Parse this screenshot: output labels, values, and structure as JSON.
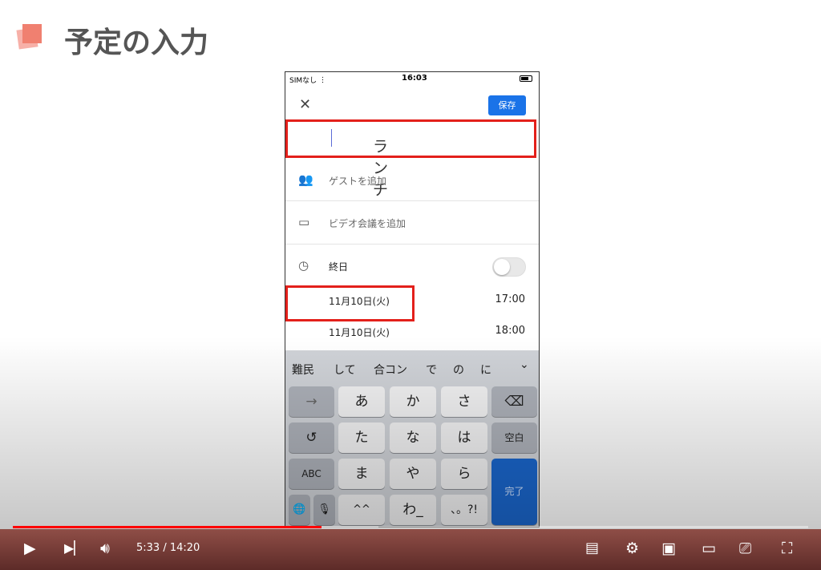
{
  "slide": {
    "title": "予定の入力"
  },
  "phone": {
    "status": {
      "carrier": "SIMなし",
      "time": "16:03"
    },
    "header": {
      "close": "✕",
      "save_label": "保存"
    },
    "event_title": "ランチ",
    "rows": [
      {
        "icon": "guests-icon",
        "label": "ゲストを追加"
      },
      {
        "icon": "video-icon",
        "label": "ビデオ会議を追加"
      },
      {
        "icon": "clock-icon",
        "label": "終日"
      }
    ],
    "all_day_toggle": false,
    "start": {
      "date": "11月10日(火)",
      "time": "17:00"
    },
    "end": {
      "date": "11月10日(火)",
      "time": "18:00"
    },
    "keyboard": {
      "suggestions": [
        "難民",
        "して",
        "合コン",
        "で",
        "の",
        "に"
      ],
      "keys": {
        "arrow": "→",
        "a": "あ",
        "ka": "か",
        "sa": "さ",
        "backspace": "⌫",
        "undo": "↺",
        "ta": "た",
        "na": "な",
        "ha": "は",
        "space": "空白",
        "abc": "ABC",
        "ma": "ま",
        "ya": "や",
        "ra": "ら",
        "done": "完了",
        "globe": "🌐",
        "mic": "🎙",
        "emoticon": "^^",
        "wa": "わ_",
        "punct": "、。?!"
      }
    }
  },
  "player": {
    "current_time": "5:33",
    "duration": "14:20",
    "time_display": "5:33 / 14:20",
    "progress_percent": 38.8,
    "accent": "#ff0000"
  }
}
